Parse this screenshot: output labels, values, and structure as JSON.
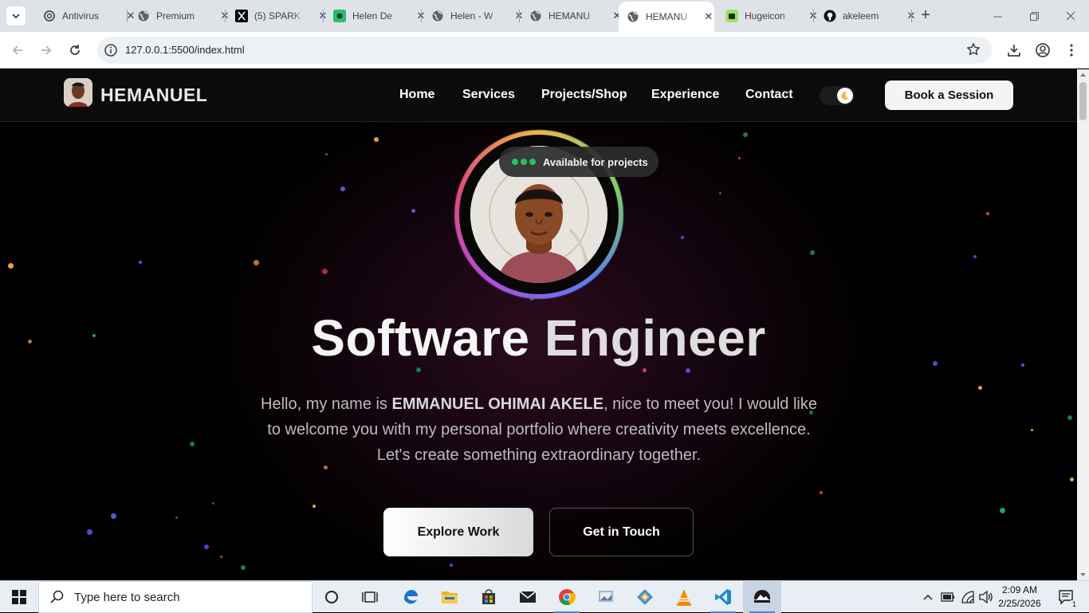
{
  "browser": {
    "tabs": [
      {
        "title": "Antivirus",
        "favicon": "chatgpt-icon"
      },
      {
        "title": "Premium",
        "favicon": "globe-icon"
      },
      {
        "title": "(5) SPARK",
        "favicon": "x-logo-icon"
      },
      {
        "title": "Helen De",
        "favicon": "app-icon"
      },
      {
        "title": "Helen - W",
        "favicon": "globe-icon"
      },
      {
        "title": "HEMANU",
        "favicon": "globe-icon"
      },
      {
        "title": "HEMANU",
        "favicon": "globe-icon",
        "active": true
      },
      {
        "title": "Hugeicon",
        "favicon": "hugeicons-icon"
      },
      {
        "title": "akeleem",
        "favicon": "github-icon"
      }
    ],
    "url": "127.0.0.1:5500/index.html"
  },
  "site": {
    "brand": "HEMANUEL",
    "nav": [
      "Home",
      "Services",
      "Projects/Shop",
      "Experience",
      "Contact"
    ],
    "cta": "Book a Session",
    "theme_icon": "moon-icon"
  },
  "hero": {
    "badge": "Available for projects",
    "title_part1": "Software",
    "title_part2": "Engineer",
    "intro_before": "Hello, my name is ",
    "intro_name": "EMMANUEL OHIMAI AKELE",
    "intro_after": ", nice to meet you! I would like to welcome you with my personal portfolio where creativity meets excellence. Let's create something extraordinary together.",
    "primary_button": "Explore Work",
    "secondary_button": "Get in Touch"
  },
  "taskbar": {
    "search_placeholder": "Type here to search",
    "time": "2:09 AM",
    "date": "2/25/2026",
    "notification_count": "1"
  },
  "colors": {
    "accent_green": "#22c55e",
    "page_background": "#000000",
    "glow": "#2b0c1e"
  }
}
